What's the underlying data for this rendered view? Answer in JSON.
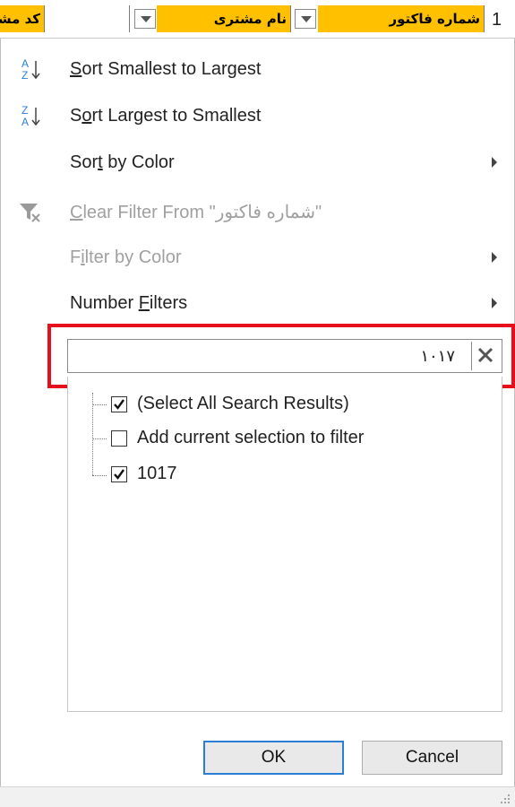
{
  "header": {
    "row_number": "1",
    "columns": [
      {
        "label": "شماره فاکتور"
      },
      {
        "label": "نام مشتری"
      },
      {
        "label": "کد مشتر"
      }
    ]
  },
  "menu": {
    "items": [
      {
        "label_pre": "",
        "label_ul": "S",
        "label_post": "ort Smallest to Largest",
        "icon": "sort-a-to-z-icon",
        "enabled": true
      },
      {
        "label_pre": "S",
        "label_ul": "o",
        "label_post": "rt Largest to Smallest",
        "icon": "sort-z-to-a-icon",
        "enabled": true
      },
      {
        "label_pre": "Sor",
        "label_ul": "t",
        "label_post": " by Color",
        "has_submenu": true,
        "enabled": true
      },
      {
        "label_pre": "",
        "label_ul": "C",
        "label_post": "lear Filter From \"شماره فاکتور\"",
        "icon": "clear-filter-icon",
        "enabled": false
      },
      {
        "label_pre": "F",
        "label_ul": "i",
        "label_post": "lter by Color",
        "has_submenu": true,
        "enabled": false
      },
      {
        "label_pre": "Number ",
        "label_ul": "F",
        "label_post": "ilters",
        "has_submenu": true,
        "enabled": true
      }
    ]
  },
  "search": {
    "value": "۱۰۱۷",
    "clear_icon": "close-icon"
  },
  "checklist": [
    {
      "label": "(Select All Search Results)",
      "checked": true
    },
    {
      "label": "Add current selection to filter",
      "checked": false
    },
    {
      "label": "1017",
      "checked": true
    }
  ],
  "buttons": {
    "ok": "OK",
    "cancel": "Cancel"
  },
  "colors": {
    "header_fill": "#ffc000",
    "highlight_border": "#e5101b",
    "ok_border": "#2a7fd4"
  }
}
